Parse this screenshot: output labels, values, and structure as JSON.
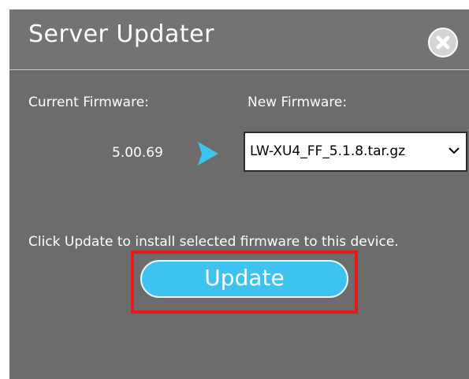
{
  "dialog": {
    "title": "Server Updater",
    "close_icon": "close-circle-icon"
  },
  "firmware": {
    "current_label": "Current Firmware:",
    "current_version": "5.00.69",
    "new_label": "New Firmware:",
    "selected_file": "LW-XU4_FF_5.1.8.tar.gz",
    "arrow_icon": "play-arrow-icon",
    "dropdown_icon": "chevron-down-icon"
  },
  "instructions": "Click Update to install selected firmware to this device.",
  "update_button": {
    "label": "Update",
    "highlight_color": "#e51b1b"
  },
  "colors": {
    "panel": "#6c6c6c",
    "title_bar": "#737373",
    "accent": "#3ec3f0"
  }
}
